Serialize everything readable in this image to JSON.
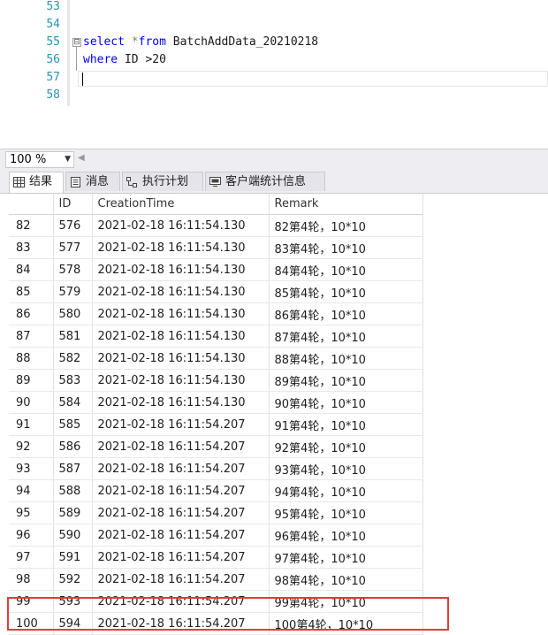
{
  "editor": {
    "lines": [
      {
        "num": "53",
        "code": ""
      },
      {
        "num": "54",
        "code": ""
      },
      {
        "num": "55",
        "kw1": "select",
        "op": " *",
        "kw2": "from",
        "rest": " BatchAddData_20210218"
      },
      {
        "num": "56",
        "kw1": "where",
        "rest": " ID >20"
      },
      {
        "num": "57",
        "code": ""
      },
      {
        "num": "58",
        "code": ""
      }
    ],
    "fold_symbol": "⊟"
  },
  "zoom": {
    "value": "100 %",
    "dropdown": "▼",
    "scroll_left": "◀"
  },
  "tabs": [
    {
      "label": "结果",
      "icon": "grid-icon"
    },
    {
      "label": "消息",
      "icon": "messages-icon"
    },
    {
      "label": "执行计划",
      "icon": "execution-plan-icon"
    },
    {
      "label": "客户端统计信息",
      "icon": "client-stats-icon"
    }
  ],
  "grid": {
    "columns": [
      "",
      "ID",
      "CreationTime",
      "Remark"
    ],
    "rows": [
      [
        "82",
        "576",
        "2021-02-18 16:11:54.130",
        "82第4轮，10*10"
      ],
      [
        "83",
        "577",
        "2021-02-18 16:11:54.130",
        "83第4轮，10*10"
      ],
      [
        "84",
        "578",
        "2021-02-18 16:11:54.130",
        "84第4轮，10*10"
      ],
      [
        "85",
        "579",
        "2021-02-18 16:11:54.130",
        "85第4轮，10*10"
      ],
      [
        "86",
        "580",
        "2021-02-18 16:11:54.130",
        "86第4轮，10*10"
      ],
      [
        "87",
        "581",
        "2021-02-18 16:11:54.130",
        "87第4轮，10*10"
      ],
      [
        "88",
        "582",
        "2021-02-18 16:11:54.130",
        "88第4轮，10*10"
      ],
      [
        "89",
        "583",
        "2021-02-18 16:11:54.130",
        "89第4轮，10*10"
      ],
      [
        "90",
        "584",
        "2021-02-18 16:11:54.130",
        "90第4轮，10*10"
      ],
      [
        "91",
        "585",
        "2021-02-18 16:11:54.207",
        "91第4轮，10*10"
      ],
      [
        "92",
        "586",
        "2021-02-18 16:11:54.207",
        "92第4轮，10*10"
      ],
      [
        "93",
        "587",
        "2021-02-18 16:11:54.207",
        "93第4轮，10*10"
      ],
      [
        "94",
        "588",
        "2021-02-18 16:11:54.207",
        "94第4轮，10*10"
      ],
      [
        "95",
        "589",
        "2021-02-18 16:11:54.207",
        "95第4轮，10*10"
      ],
      [
        "96",
        "590",
        "2021-02-18 16:11:54.207",
        "96第4轮，10*10"
      ],
      [
        "97",
        "591",
        "2021-02-18 16:11:54.207",
        "97第4轮，10*10"
      ],
      [
        "98",
        "592",
        "2021-02-18 16:11:54.207",
        "98第4轮，10*10"
      ],
      [
        "99",
        "593",
        "2021-02-18 16:11:54.207",
        "99第4轮，10*10"
      ],
      [
        "100",
        "594",
        "2021-02-18 16:11:54.207",
        "100第4轮，10*10"
      ]
    ]
  },
  "colors": {
    "keyword": "#0000ff",
    "line_number": "#2b91af",
    "highlight_box": "#e03c3c"
  }
}
